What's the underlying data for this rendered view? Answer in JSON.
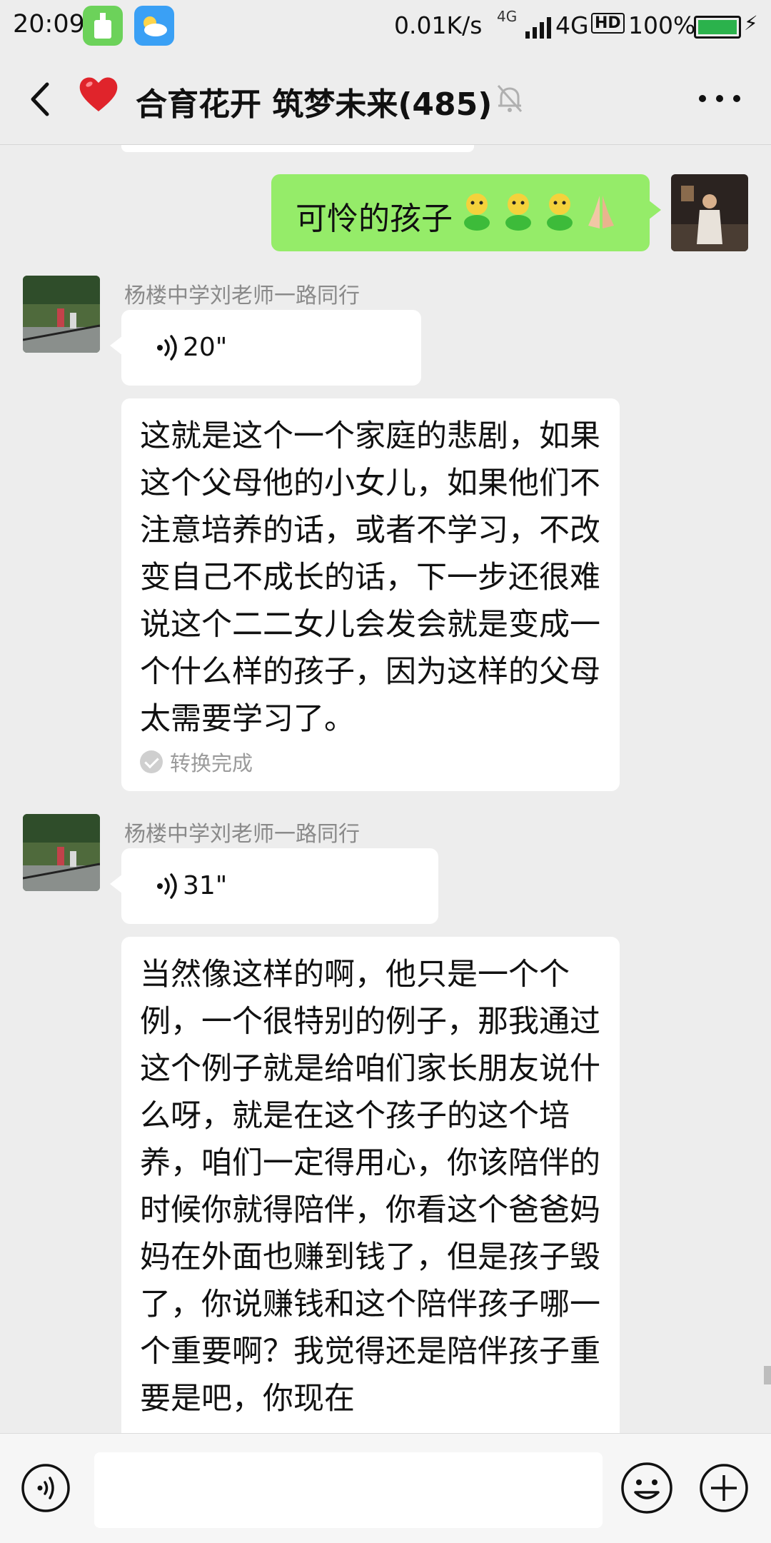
{
  "status_bar": {
    "time": "20:09",
    "speed": "0.01K/s",
    "network_small": "4G",
    "network": "4G",
    "hd": "HD",
    "battery": "100%",
    "battery_level": 1.0
  },
  "header": {
    "title": "合育花开 筑梦未来(485)",
    "icons": [
      "back-arrow-icon",
      "red-heart-icon",
      "mute-bell-icon",
      "more-dots-icon"
    ]
  },
  "messages": [
    {
      "type": "text",
      "from_me": true,
      "text": "可怜的孩子",
      "emojis": [
        "🙂",
        "🙂",
        "🙂",
        "🙏"
      ]
    },
    {
      "type": "voice",
      "sender": "杨楼中学刘老师一路同行",
      "duration": "20\"",
      "transcript": "这就是这个一个家庭的悲剧，如果这个父母他的小女儿，如果他们不注意培养的话，或者不学习，不改变自己不成长的话，下一步还很难说这个二二女儿会发会就是变成一个什么样的孩子，因为这样的父母太需要学习了。",
      "transcript_status": "转换完成"
    },
    {
      "type": "voice",
      "sender": "杨楼中学刘老师一路同行",
      "duration": "31\"",
      "transcript": "当然像这样的啊，他只是一个个例，一个很特别的例子，那我通过这个例子就是给咱们家长朋友说什么呀，就是在这个孩子的这个培养，咱们一定得用心，你该陪伴的时候你就得陪伴，你看这个爸爸妈妈在外面也赚到钱了，但是孩子毁了，你说赚钱和这个陪伴孩子哪一个重要啊？我觉得还是陪伴孩子重要是吧，你现在"
    }
  ],
  "input_bar": {
    "icons": [
      "voice-input-icon",
      "emoji-icon",
      "plus-icon"
    ],
    "placeholder": ""
  },
  "colors": {
    "my_bubble": "#95ec69",
    "their_bubble": "#ffffff",
    "background": "#ededed"
  }
}
